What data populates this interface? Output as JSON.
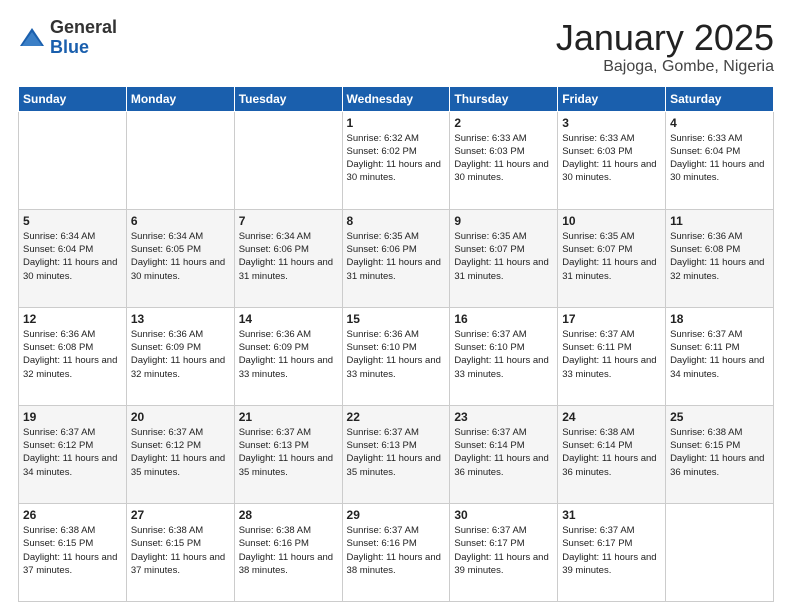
{
  "logo": {
    "general": "General",
    "blue": "Blue"
  },
  "header": {
    "month": "January 2025",
    "location": "Bajoga, Gombe, Nigeria"
  },
  "weekdays": [
    "Sunday",
    "Monday",
    "Tuesday",
    "Wednesday",
    "Thursday",
    "Friday",
    "Saturday"
  ],
  "weeks": [
    [
      {
        "day": "",
        "info": ""
      },
      {
        "day": "",
        "info": ""
      },
      {
        "day": "",
        "info": ""
      },
      {
        "day": "1",
        "info": "Sunrise: 6:32 AM\nSunset: 6:02 PM\nDaylight: 11 hours and 30 minutes."
      },
      {
        "day": "2",
        "info": "Sunrise: 6:33 AM\nSunset: 6:03 PM\nDaylight: 11 hours and 30 minutes."
      },
      {
        "day": "3",
        "info": "Sunrise: 6:33 AM\nSunset: 6:03 PM\nDaylight: 11 hours and 30 minutes."
      },
      {
        "day": "4",
        "info": "Sunrise: 6:33 AM\nSunset: 6:04 PM\nDaylight: 11 hours and 30 minutes."
      }
    ],
    [
      {
        "day": "5",
        "info": "Sunrise: 6:34 AM\nSunset: 6:04 PM\nDaylight: 11 hours and 30 minutes."
      },
      {
        "day": "6",
        "info": "Sunrise: 6:34 AM\nSunset: 6:05 PM\nDaylight: 11 hours and 30 minutes."
      },
      {
        "day": "7",
        "info": "Sunrise: 6:34 AM\nSunset: 6:06 PM\nDaylight: 11 hours and 31 minutes."
      },
      {
        "day": "8",
        "info": "Sunrise: 6:35 AM\nSunset: 6:06 PM\nDaylight: 11 hours and 31 minutes."
      },
      {
        "day": "9",
        "info": "Sunrise: 6:35 AM\nSunset: 6:07 PM\nDaylight: 11 hours and 31 minutes."
      },
      {
        "day": "10",
        "info": "Sunrise: 6:35 AM\nSunset: 6:07 PM\nDaylight: 11 hours and 31 minutes."
      },
      {
        "day": "11",
        "info": "Sunrise: 6:36 AM\nSunset: 6:08 PM\nDaylight: 11 hours and 32 minutes."
      }
    ],
    [
      {
        "day": "12",
        "info": "Sunrise: 6:36 AM\nSunset: 6:08 PM\nDaylight: 11 hours and 32 minutes."
      },
      {
        "day": "13",
        "info": "Sunrise: 6:36 AM\nSunset: 6:09 PM\nDaylight: 11 hours and 32 minutes."
      },
      {
        "day": "14",
        "info": "Sunrise: 6:36 AM\nSunset: 6:09 PM\nDaylight: 11 hours and 33 minutes."
      },
      {
        "day": "15",
        "info": "Sunrise: 6:36 AM\nSunset: 6:10 PM\nDaylight: 11 hours and 33 minutes."
      },
      {
        "day": "16",
        "info": "Sunrise: 6:37 AM\nSunset: 6:10 PM\nDaylight: 11 hours and 33 minutes."
      },
      {
        "day": "17",
        "info": "Sunrise: 6:37 AM\nSunset: 6:11 PM\nDaylight: 11 hours and 33 minutes."
      },
      {
        "day": "18",
        "info": "Sunrise: 6:37 AM\nSunset: 6:11 PM\nDaylight: 11 hours and 34 minutes."
      }
    ],
    [
      {
        "day": "19",
        "info": "Sunrise: 6:37 AM\nSunset: 6:12 PM\nDaylight: 11 hours and 34 minutes."
      },
      {
        "day": "20",
        "info": "Sunrise: 6:37 AM\nSunset: 6:12 PM\nDaylight: 11 hours and 35 minutes."
      },
      {
        "day": "21",
        "info": "Sunrise: 6:37 AM\nSunset: 6:13 PM\nDaylight: 11 hours and 35 minutes."
      },
      {
        "day": "22",
        "info": "Sunrise: 6:37 AM\nSunset: 6:13 PM\nDaylight: 11 hours and 35 minutes."
      },
      {
        "day": "23",
        "info": "Sunrise: 6:37 AM\nSunset: 6:14 PM\nDaylight: 11 hours and 36 minutes."
      },
      {
        "day": "24",
        "info": "Sunrise: 6:38 AM\nSunset: 6:14 PM\nDaylight: 11 hours and 36 minutes."
      },
      {
        "day": "25",
        "info": "Sunrise: 6:38 AM\nSunset: 6:15 PM\nDaylight: 11 hours and 36 minutes."
      }
    ],
    [
      {
        "day": "26",
        "info": "Sunrise: 6:38 AM\nSunset: 6:15 PM\nDaylight: 11 hours and 37 minutes."
      },
      {
        "day": "27",
        "info": "Sunrise: 6:38 AM\nSunset: 6:15 PM\nDaylight: 11 hours and 37 minutes."
      },
      {
        "day": "28",
        "info": "Sunrise: 6:38 AM\nSunset: 6:16 PM\nDaylight: 11 hours and 38 minutes."
      },
      {
        "day": "29",
        "info": "Sunrise: 6:37 AM\nSunset: 6:16 PM\nDaylight: 11 hours and 38 minutes."
      },
      {
        "day": "30",
        "info": "Sunrise: 6:37 AM\nSunset: 6:17 PM\nDaylight: 11 hours and 39 minutes."
      },
      {
        "day": "31",
        "info": "Sunrise: 6:37 AM\nSunset: 6:17 PM\nDaylight: 11 hours and 39 minutes."
      },
      {
        "day": "",
        "info": ""
      }
    ]
  ]
}
